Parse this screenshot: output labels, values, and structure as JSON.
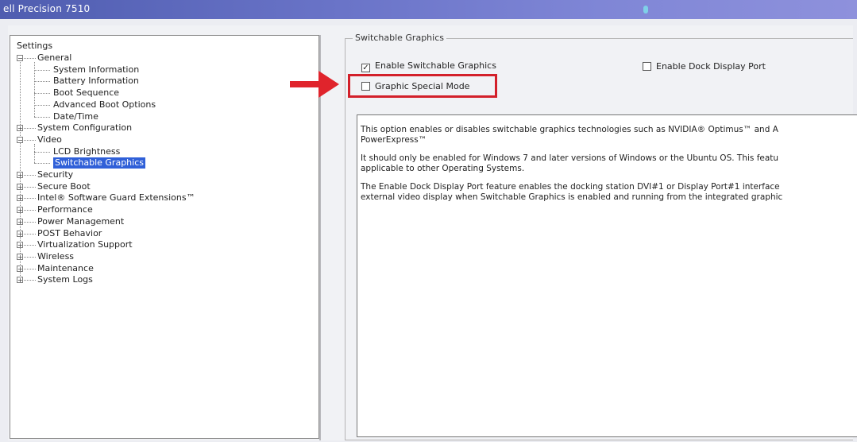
{
  "window": {
    "title": "ell Precision 7510"
  },
  "tree": {
    "root": "Settings",
    "items": [
      {
        "label": "General",
        "level": 1,
        "expander": "−"
      },
      {
        "label": "System Information",
        "level": 2
      },
      {
        "label": "Battery Information",
        "level": 2
      },
      {
        "label": "Boot Sequence",
        "level": 2
      },
      {
        "label": "Advanced Boot Options",
        "level": 2
      },
      {
        "label": "Date/Time",
        "level": 2
      },
      {
        "label": "System Configuration",
        "level": 1,
        "expander": "+"
      },
      {
        "label": "Video",
        "level": 1,
        "expander": "−"
      },
      {
        "label": "LCD Brightness",
        "level": 2
      },
      {
        "label": "Switchable Graphics",
        "level": 2,
        "selected": true
      },
      {
        "label": "Security",
        "level": 1,
        "expander": "+"
      },
      {
        "label": "Secure Boot",
        "level": 1,
        "expander": "+"
      },
      {
        "label": "Intel® Software Guard Extensions™",
        "level": 1,
        "expander": "+"
      },
      {
        "label": "Performance",
        "level": 1,
        "expander": "+"
      },
      {
        "label": "Power Management",
        "level": 1,
        "expander": "+"
      },
      {
        "label": "POST Behavior",
        "level": 1,
        "expander": "+"
      },
      {
        "label": "Virtualization Support",
        "level": 1,
        "expander": "+"
      },
      {
        "label": "Wireless",
        "level": 1,
        "expander": "+"
      },
      {
        "label": "Maintenance",
        "level": 1,
        "expander": "+"
      },
      {
        "label": "System Logs",
        "level": 1,
        "expander": "+"
      }
    ]
  },
  "group": {
    "legend": "Switchable Graphics",
    "enable_switchable": {
      "label": "Enable Switchable Graphics",
      "checked": true,
      "mark": "✓"
    },
    "enable_dock": {
      "label": "Enable Dock Display Port",
      "checked": false
    },
    "special_mode": {
      "label": "Graphic Special Mode",
      "checked": false
    }
  },
  "description": {
    "p1a": "This option enables or disables switchable graphics technologies such as NVIDIA® Optimus™ and A",
    "p1b": "PowerExpress™",
    "p2a": "It should only be enabled for Windows 7 and later versions of Windows or the Ubuntu OS. This featu",
    "p2b": "applicable to other Operating Systems.",
    "p3a": "The Enable Dock Display Port feature enables the docking station DVI#1 or Display Port#1 interface",
    "p3b": "external video display when Switchable Graphics is enabled and running from the integrated graphic"
  },
  "colors": {
    "highlight": "#d3202a",
    "arrow": "#e0242c",
    "selection": "#3060d8"
  }
}
